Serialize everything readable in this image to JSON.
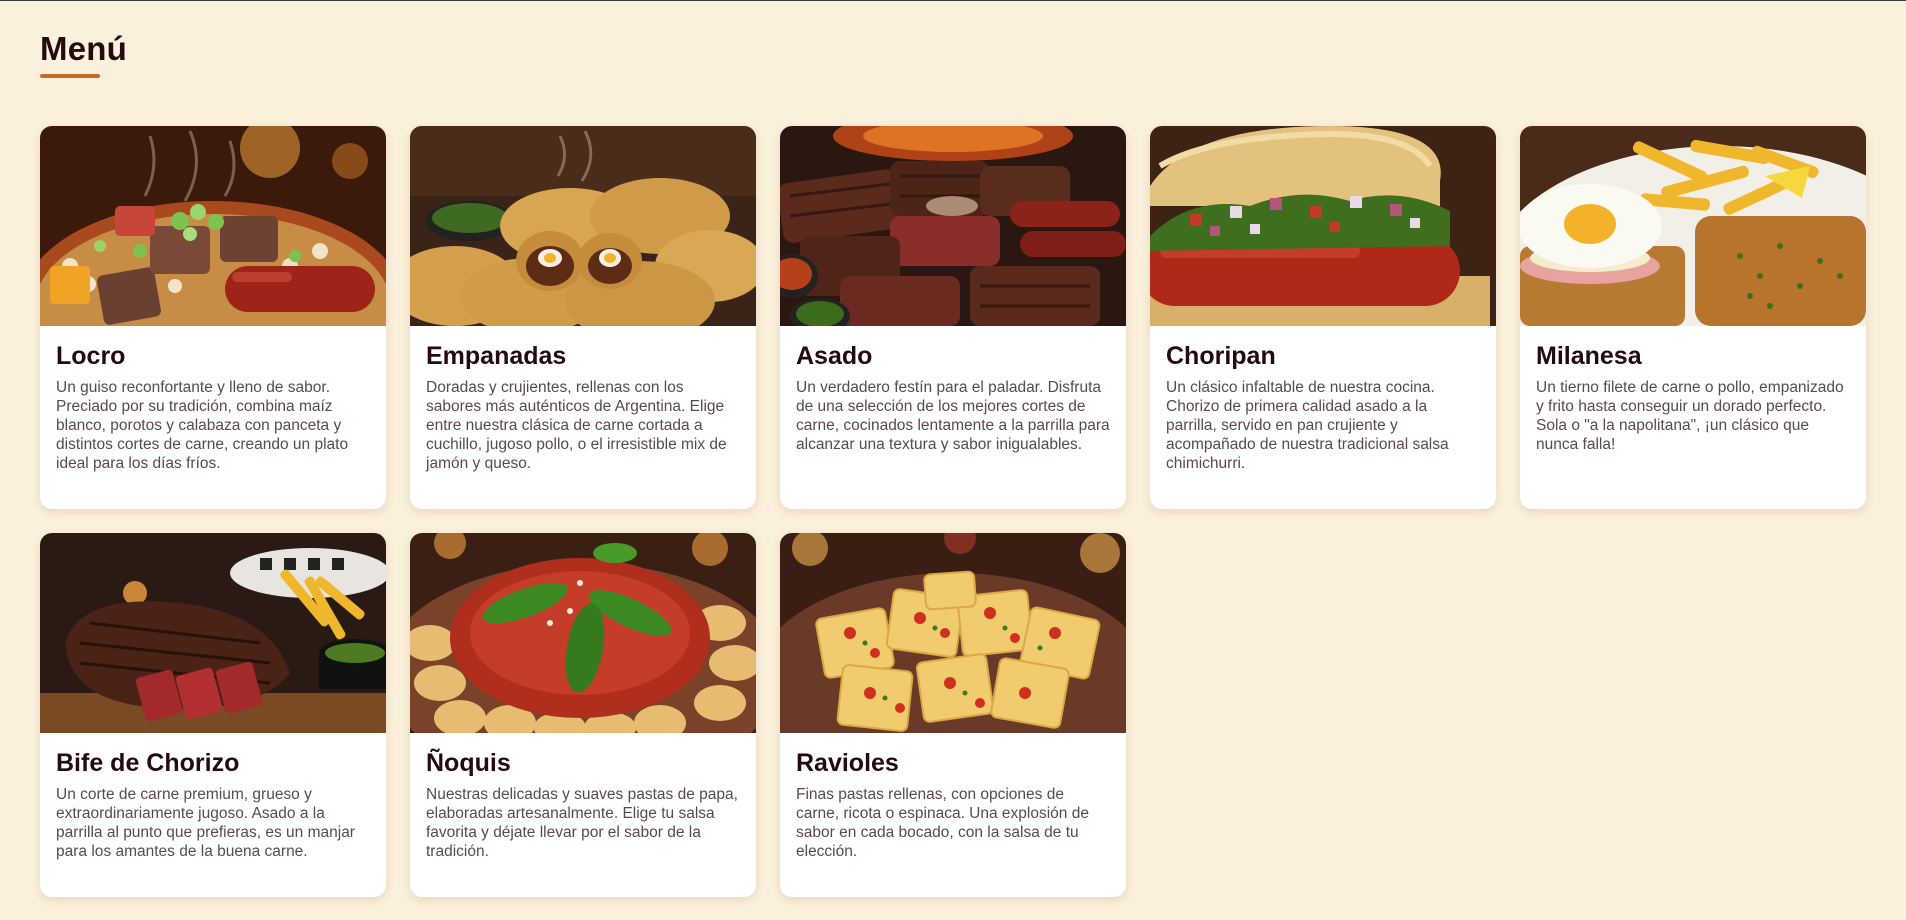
{
  "page": {
    "title": "Menú",
    "colors": {
      "background": "#fbf0db",
      "accent": "#c8692c",
      "title": "#240b0f",
      "text": "#5a4a4a",
      "card": "#ffffff"
    }
  },
  "menu": {
    "items": [
      {
        "name": "Locro",
        "image": "locro-photo",
        "description": "Un guiso reconfortante y lleno de sabor. Preciado por su tradición, combina maíz blanco, porotos y calabaza con panceta y distintos cortes de carne, creando un plato ideal para los días fríos."
      },
      {
        "name": "Empanadas",
        "image": "empanadas-photo",
        "description": "Doradas y crujientes, rellenas con los sabores más auténticos de Argentina. Elige entre nuestra clásica de carne cortada a cuchillo, jugoso pollo, o el irresistible mix de jamón y queso."
      },
      {
        "name": "Asado",
        "image": "asado-photo",
        "description": "Un verdadero festín para el paladar. Disfruta de una selección de los mejores cortes de carne, cocinados lentamente a la parrilla para alcanzar una textura y sabor inigualables."
      },
      {
        "name": "Choripan",
        "image": "choripan-photo",
        "description": "Un clásico infaltable de nuestra cocina. Chorizo de primera calidad asado a la parrilla, servido en pan crujiente y acompañado de nuestra tradicional salsa chimichurri."
      },
      {
        "name": "Milanesa",
        "image": "milanesa-photo",
        "description": "Un tierno filete de carne o pollo, empanizado y frito hasta conseguir un dorado perfecto. Sola o \"a la napolitana\", ¡un clásico que nunca falla!"
      },
      {
        "name": "Bife de Chorizo",
        "image": "bife-de-chorizo-photo",
        "description": "Un corte de carne premium, grueso y extraordinariamente jugoso. Asado a la parrilla al punto que prefieras, es un manjar para los amantes de la buena carne."
      },
      {
        "name": "Ñoquis",
        "image": "noquis-photo",
        "description": "Nuestras delicadas y suaves pastas de papa, elaboradas artesanalmente. Elige tu salsa favorita y déjate llevar por el sabor de la tradición."
      },
      {
        "name": "Ravioles",
        "image": "ravioles-photo",
        "description": "Finas pastas rellenas, con opciones de carne, ricota o espinaca. Una explosión de sabor en cada bocado, con la salsa de tu elección."
      }
    ]
  }
}
